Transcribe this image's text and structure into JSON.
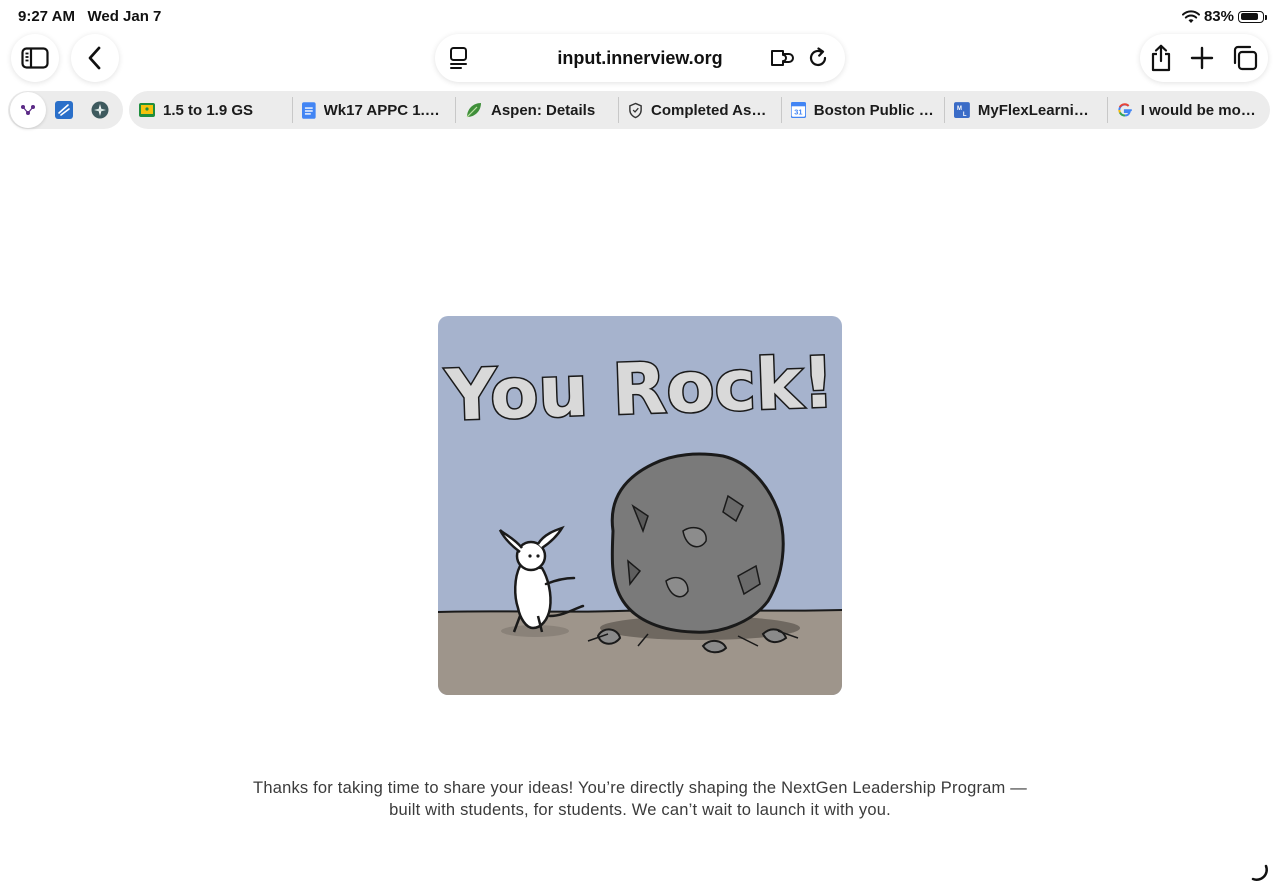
{
  "status_bar": {
    "time": "9:27 AM",
    "date": "Wed Jan 7",
    "battery_percent": "83%",
    "battery_level": 0.83
  },
  "address_bar": {
    "url": "input.innerview.org"
  },
  "pinned_tabs": [
    {
      "icon": "purple-dots-icon"
    },
    {
      "icon": "blue-app-icon"
    },
    {
      "icon": "compass-icon"
    }
  ],
  "tabs": [
    {
      "title": "1.5 to 1.9 GS",
      "icon": "classroom-icon"
    },
    {
      "title": "Wk17 APPC 1.5…",
      "icon": "docs-icon"
    },
    {
      "title": "Aspen: Details",
      "icon": "aspen-leaf-icon"
    },
    {
      "title": "Completed Assi…",
      "icon": "shield-icon"
    },
    {
      "title": "Boston Public S…",
      "icon": "calendar-icon"
    },
    {
      "title": "MyFlexLearnin…",
      "icon": "flex-learning-icon"
    },
    {
      "title": "I would be mor…",
      "icon": "google-icon"
    }
  ],
  "content": {
    "image_text": "You Rock!",
    "thanks_line1": "Thanks for taking  time to share your ideas! You’re directly shaping the NextGen Leadership Program —",
    "thanks_line2": "built with students, for students. We can’t wait to launch it with you."
  }
}
